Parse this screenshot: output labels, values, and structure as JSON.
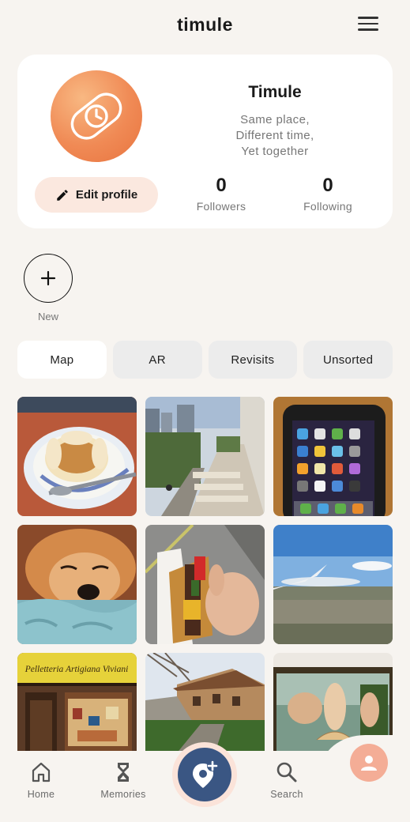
{
  "header": {
    "title": "timule"
  },
  "profile": {
    "name": "Timule",
    "bio": [
      "Same place,",
      "Different time,",
      "Yet together"
    ],
    "edit_label": "Edit profile",
    "followers_count": "0",
    "followers_label": "Followers",
    "following_count": "0",
    "following_label": "Following"
  },
  "new_story": {
    "label": "New"
  },
  "tabs": [
    {
      "label": "Map",
      "active": true
    },
    {
      "label": "AR",
      "active": false
    },
    {
      "label": "Revisits",
      "active": false
    },
    {
      "label": "Unsorted",
      "active": false
    }
  ],
  "photos": [
    {
      "subject": "dessert-plate"
    },
    {
      "subject": "city-stairs"
    },
    {
      "subject": "old-iphone"
    },
    {
      "subject": "sleeping-dog"
    },
    {
      "subject": "sandwich-in-hand"
    },
    {
      "subject": "airplane-window-view"
    },
    {
      "subject": "storefront",
      "sign_text": "Pelletteria Artigiana Viviani"
    },
    {
      "subject": "hillside-building"
    },
    {
      "subject": "birth-of-venus-painting"
    }
  ],
  "nav": {
    "home_label": "Home",
    "memories_label": "Memories",
    "search_label": "Search"
  },
  "colors": {
    "background": "#f7f4f0",
    "avatar_orange": "#f08a55",
    "edit_button_bg": "#fbe8df",
    "add_button_blue": "#3a5683",
    "profile_fab": "#f4ad96"
  }
}
